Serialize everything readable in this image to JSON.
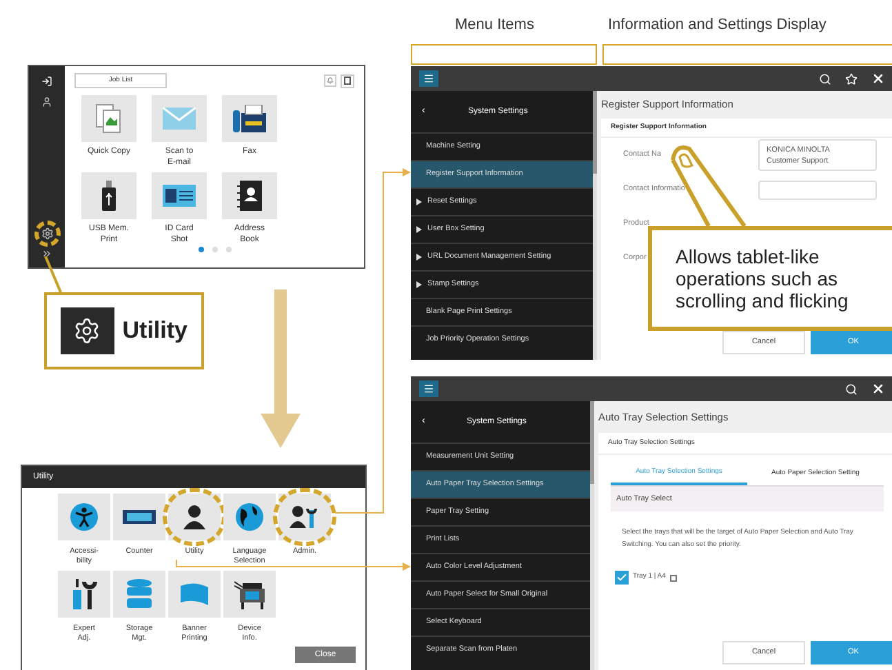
{
  "headers": {
    "menu_items": "Menu Items",
    "info_display": "Information and Settings Display"
  },
  "home": {
    "job_list": "Job List",
    "utility_button": {
      "highlighted": true
    },
    "apps": [
      {
        "label": "Quick Copy"
      },
      {
        "label": "Scan to\nE-mail"
      },
      {
        "label": "Fax"
      },
      {
        "label": "USB Mem.\nPrint"
      },
      {
        "label": "ID Card\nShot"
      },
      {
        "label": "Address\nBook"
      }
    ],
    "page_dots": [
      {
        "selected": true
      },
      {
        "selected": false
      },
      {
        "selected": false
      }
    ]
  },
  "utility_callout": "Utility",
  "utility_dialog": {
    "title": "Utility",
    "items": [
      {
        "label": "Accessi-\nbility",
        "highlighted": false
      },
      {
        "label": "Counter",
        "highlighted": false
      },
      {
        "label": "Utility",
        "highlighted": true
      },
      {
        "label": "Language\nSelection",
        "highlighted": false
      },
      {
        "label": "Admin.",
        "highlighted": true
      },
      {
        "label": "Expert\nAdj.",
        "highlighted": false
      },
      {
        "label": "Storage\nMgt.",
        "highlighted": false
      },
      {
        "label": "Banner\nPrinting",
        "highlighted": false
      },
      {
        "label": "Device\nInfo.",
        "highlighted": false
      }
    ],
    "close": "Close"
  },
  "register_screen": {
    "star_button": true,
    "back": "‹",
    "sidebar_title": "System Settings",
    "menu": [
      {
        "label": "Machine Setting",
        "expandable": false,
        "selected": false
      },
      {
        "label": "Register Support Information",
        "expandable": false,
        "selected": true
      },
      {
        "label": "Reset Settings",
        "expandable": true,
        "selected": false
      },
      {
        "label": "User Box Setting",
        "expandable": true,
        "selected": false
      },
      {
        "label": "URL Document Management Setting",
        "expandable": true,
        "selected": false
      },
      {
        "label": "Stamp Settings",
        "expandable": true,
        "selected": false
      },
      {
        "label": "Blank Page Print Settings",
        "expandable": false,
        "selected": false
      },
      {
        "label": "Job Priority Operation Settings",
        "expandable": false,
        "selected": false
      }
    ],
    "title": "Register Support Information",
    "section": "Register Support Information",
    "fields": [
      {
        "label": "Contact Na",
        "value": "KONICA MINOLTA\nCustomer Support"
      },
      {
        "label": "Contact Informatio"
      },
      {
        "label": "Product"
      },
      {
        "label": "Corpor"
      }
    ],
    "cancel": "Cancel",
    "ok": "OK"
  },
  "callout": "Allows tablet-like operations such as scrolling and flicking",
  "tray_screen": {
    "star_button": false,
    "back": "‹",
    "sidebar_title": "System Settings",
    "menu": [
      {
        "label": "Measurement Unit Setting",
        "expandable": false,
        "selected": false
      },
      {
        "label": "Auto Paper Tray Selection Settings",
        "expandable": false,
        "selected": true
      },
      {
        "label": "Paper Tray Setting",
        "expandable": false,
        "selected": false
      },
      {
        "label": "Print Lists",
        "expandable": false,
        "selected": false
      },
      {
        "label": "Auto Color Level Adjustment",
        "expandable": false,
        "selected": false
      },
      {
        "label": "Auto Paper Select for Small Original",
        "expandable": false,
        "selected": false
      },
      {
        "label": "Select Keyboard",
        "expandable": false,
        "selected": false
      },
      {
        "label": "Separate Scan from Platen",
        "expandable": false,
        "selected": false
      }
    ],
    "title": "Auto Tray Selection Settings",
    "section": "Auto Tray Selection Settings",
    "tabs": [
      {
        "label": "Auto Tray Selection Settings",
        "selected": true
      },
      {
        "label": "Auto Paper Selection Setting",
        "selected": false
      }
    ],
    "group": "Auto Tray Select",
    "description": "Select the trays that will be the target of Auto Paper Selection and Auto Tray Switching. You can also set the priority.",
    "trays": [
      {
        "label": "Tray 1 | A4",
        "checked": true
      }
    ],
    "cancel": "Cancel",
    "ok": "OK"
  }
}
